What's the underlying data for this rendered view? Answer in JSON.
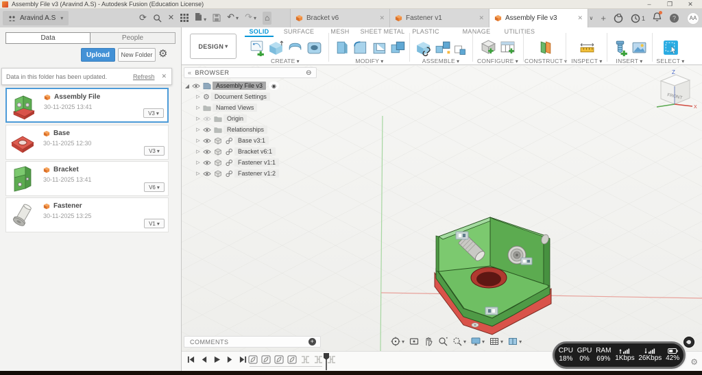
{
  "window": {
    "title": "Assembly File v3 (Aravind A.S) - Autodesk Fusion (Education License)"
  },
  "appbar": {
    "user": "Aravind A.S",
    "job_count": "1",
    "avatar": "AA",
    "doc_tabs": [
      {
        "label": "Bracket v6"
      },
      {
        "label": "Fastener v1"
      },
      {
        "label": "Assembly File v3"
      }
    ]
  },
  "ribbon": {
    "design": "DESIGN",
    "tabs": [
      {
        "label": "SOLID"
      },
      {
        "label": "SURFACE"
      },
      {
        "label": "MESH"
      },
      {
        "label": "SHEET METAL"
      },
      {
        "label": "PLASTIC"
      },
      {
        "label": "MANAGE"
      },
      {
        "label": "UTILITIES"
      }
    ],
    "groups": [
      {
        "label": "CREATE"
      },
      {
        "label": "MODIFY"
      },
      {
        "label": "ASSEMBLE"
      },
      {
        "label": "CONFIGURE"
      },
      {
        "label": "CONSTRUCT"
      },
      {
        "label": "INSPECT"
      },
      {
        "label": "INSERT"
      },
      {
        "label": "SELECT"
      }
    ]
  },
  "data_panel": {
    "tab_data": "Data",
    "tab_people": "People",
    "upload": "Upload",
    "new_folder": "New Folder",
    "notice": {
      "message": "Data in this folder has been updated.",
      "action": "Refresh"
    },
    "files": [
      {
        "name": "Assembly File",
        "date": "30-11-2025 13:41",
        "version": "V3"
      },
      {
        "name": "Base",
        "date": "30-11-2025 12:30",
        "version": "V3"
      },
      {
        "name": "Bracket",
        "date": "30-11-2025 13:41",
        "version": "V6"
      },
      {
        "name": "Fastener",
        "date": "30-11-2025 13:25",
        "version": "V1"
      }
    ]
  },
  "browser": {
    "title": "BROWSER",
    "root": "Assembly File v3",
    "items": [
      {
        "label": "Document Settings"
      },
      {
        "label": "Named Views"
      },
      {
        "label": "Origin"
      },
      {
        "label": "Relationships"
      },
      {
        "label": "Base v3:1"
      },
      {
        "label": "Bracket v6:1"
      },
      {
        "label": "Fastener v1:1"
      },
      {
        "label": "Fastener v1:2"
      }
    ]
  },
  "viewport": {
    "viewcube_front": "FRONT",
    "axis_x": "X",
    "axis_z": "Z"
  },
  "comments": {
    "label": "COMMENTS"
  },
  "timeline": {
    "component_features": 4,
    "joint_features": 3
  },
  "perf": {
    "cpu_label": "CPU",
    "cpu": "18%",
    "gpu_label": "GPU",
    "gpu": "0%",
    "ram_label": "RAM",
    "ram": "69%",
    "up": "1Kbps",
    "down": "26Kbps",
    "battery": "42%"
  },
  "colors": {
    "accent_blue": "#0696d7",
    "selection_blue": "#4c9bd8",
    "upload_button": "#4391d6",
    "bracket_green": "#6fbf63",
    "base_red": "#d9534a",
    "cube_orange": "#ef8c3f"
  }
}
